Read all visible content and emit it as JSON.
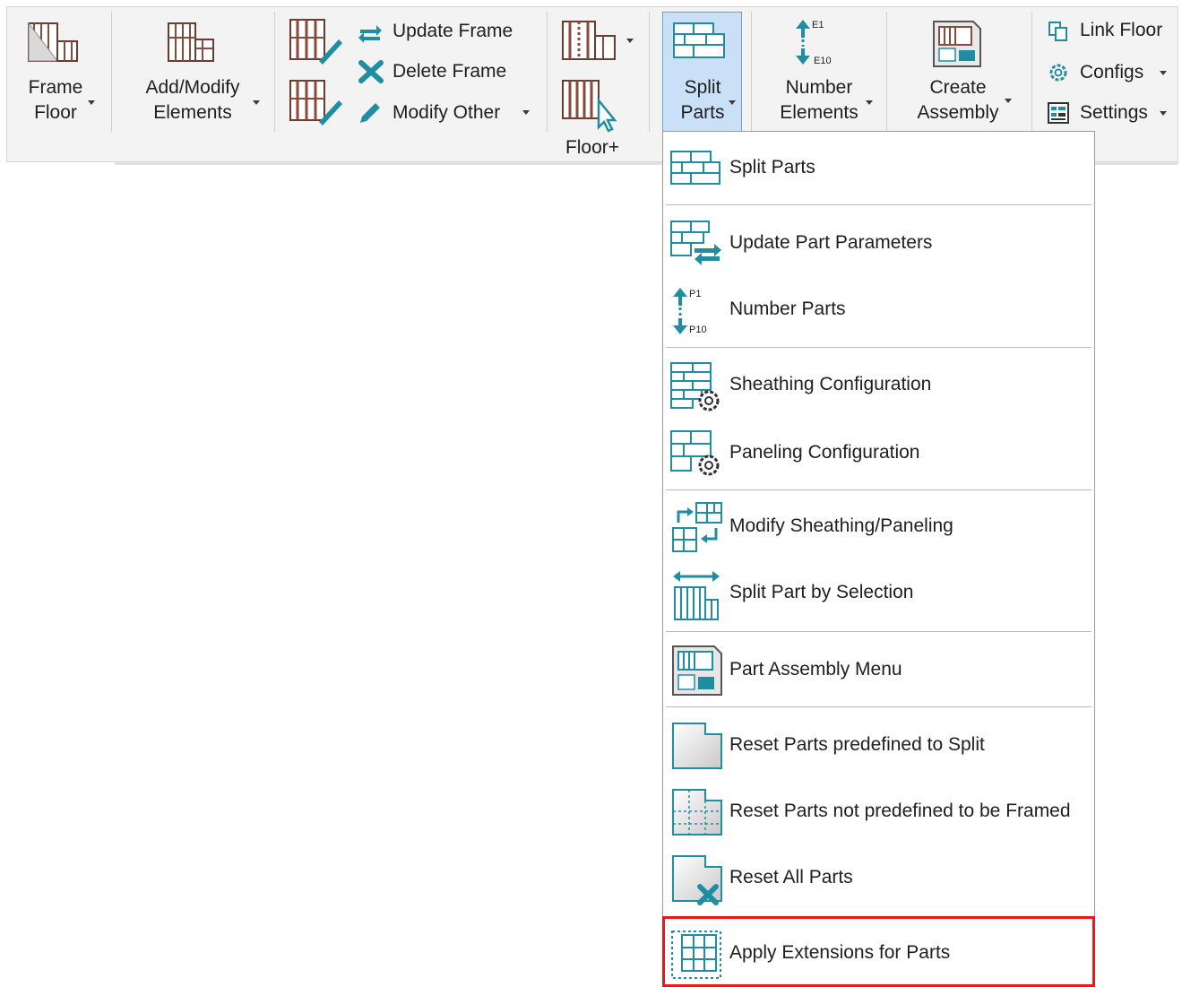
{
  "ribbon": {
    "frame_floor": {
      "line1": "Frame",
      "line2": "Floor"
    },
    "add_modify": {
      "line1": "Add/Modify",
      "line2": "Elements"
    },
    "update_frame": "Update Frame",
    "delete_frame": "Delete Frame",
    "modify_other": "Modify Other",
    "floor_plus": "Floor+",
    "split_parts": {
      "line1": "Split",
      "line2": "Parts"
    },
    "number_elements": {
      "line1": "Number",
      "line2": "Elements",
      "icon_top": "E1",
      "icon_bottom": "E10"
    },
    "create_assembly": {
      "line1": "Create",
      "line2": "Assembly"
    },
    "link_floor": "Link Floor",
    "configs": "Configs",
    "settings": "Settings"
  },
  "menu": {
    "items": [
      {
        "label": "Split Parts",
        "icon": "split-parts-icon"
      },
      {
        "label": "Update Part Parameters",
        "icon": "update-part-parameters-icon"
      },
      {
        "label": "Number Parts",
        "icon": "number-parts-icon",
        "icon_top": "P1",
        "icon_bottom": "P10"
      },
      {
        "label": "Sheathing Configuration",
        "icon": "sheathing-configuration-icon"
      },
      {
        "label": "Paneling Configuration",
        "icon": "paneling-configuration-icon"
      },
      {
        "label": "Modify Sheathing/Paneling",
        "icon": "modify-sheathing-paneling-icon"
      },
      {
        "label": "Split Part by Selection",
        "icon": "split-part-by-selection-icon"
      },
      {
        "label": "Part Assembly Menu",
        "icon": "part-assembly-menu-icon"
      },
      {
        "label": "Reset Parts predefined to Split",
        "icon": "reset-parts-predefined-icon"
      },
      {
        "label": "Reset Parts not predefined to be Framed",
        "icon": "reset-parts-not-predefined-icon"
      },
      {
        "label": "Reset All Parts",
        "icon": "reset-all-parts-icon"
      },
      {
        "label": "Apply Extensions for Parts",
        "icon": "apply-extensions-icon"
      }
    ],
    "highlighted_item": "Apply Extensions for Parts"
  },
  "colors": {
    "accent_teal": "#1f8ea3",
    "wood_brown": "#8b4a3a",
    "active_button": "#c9e0f7",
    "highlight_border": "#e8191c"
  }
}
